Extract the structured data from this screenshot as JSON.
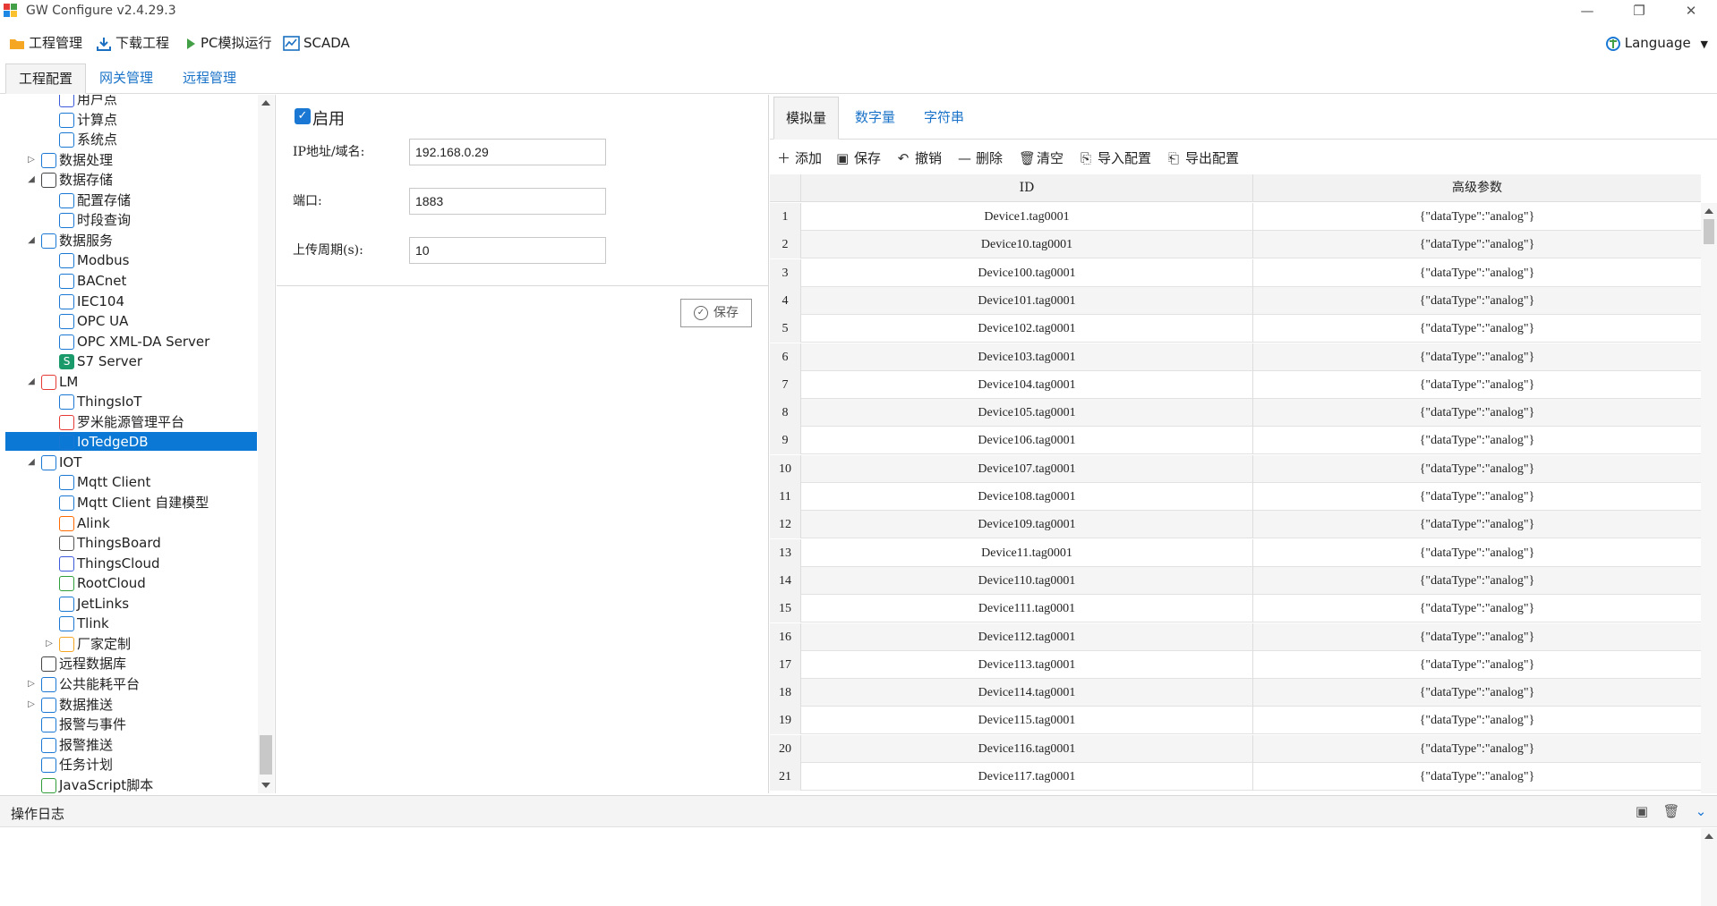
{
  "window": {
    "title": "GW Configure v2.4.29.3",
    "minimize": "—",
    "restore": "❐",
    "close": "✕"
  },
  "toolbar": {
    "project_mgmt": "工程管理",
    "download_project": "下载工程",
    "pc_simulate": "PC模拟运行",
    "scada": "SCADA",
    "language": "Language"
  },
  "main_tabs": [
    "工程配置",
    "网关管理",
    "远程管理"
  ],
  "tree": {
    "items": [
      {
        "label": "用户点",
        "icon": "user-point-icon"
      },
      {
        "label": "计算点",
        "icon": "calc-point-icon"
      },
      {
        "label": "系统点",
        "icon": "system-point-icon"
      },
      {
        "label": "数据处理",
        "icon": "data-process-icon",
        "expander": "▷"
      },
      {
        "label": "数据存储",
        "icon": "database-icon",
        "expander": "◢"
      },
      {
        "label": "配置存储",
        "icon": "gear-icon"
      },
      {
        "label": "时段查询",
        "icon": "search-icon"
      },
      {
        "label": "数据服务",
        "icon": "data-service-icon",
        "expander": "◢"
      },
      {
        "label": "Modbus",
        "icon": "modbus-icon"
      },
      {
        "label": "BACnet",
        "icon": "bacnet-icon"
      },
      {
        "label": "IEC104",
        "icon": "iec104-icon"
      },
      {
        "label": "OPC UA",
        "icon": "opcua-icon"
      },
      {
        "label": "OPC XML-DA Server",
        "icon": "opc-xml-icon"
      },
      {
        "label": "S7 Server",
        "icon": "s7-icon",
        "glyph": "S"
      },
      {
        "label": "LM",
        "icon": "lm-logo-icon",
        "expander": "◢"
      },
      {
        "label": "ThingsIoT",
        "icon": "wifi-signal-icon"
      },
      {
        "label": "罗米能源管理平台",
        "icon": "lm-logo-icon"
      },
      {
        "label": "IoTedgeDB",
        "icon": "wifi-signal-icon",
        "selected": true
      },
      {
        "label": "IOT",
        "icon": "iot-network-icon",
        "expander": "◢"
      },
      {
        "label": "Mqtt Client",
        "icon": "wifi-signal-icon"
      },
      {
        "label": "Mqtt Client 自建模型",
        "icon": "wifi-signal-icon"
      },
      {
        "label": "Alink",
        "icon": "alink-icon"
      },
      {
        "label": "ThingsBoard",
        "icon": "thingsboard-icon"
      },
      {
        "label": "ThingsCloud",
        "icon": "thingscloud-icon"
      },
      {
        "label": "RootCloud",
        "icon": "rootcloud-icon"
      },
      {
        "label": "JetLinks",
        "icon": "jetlinks-icon"
      },
      {
        "label": "Tlink",
        "icon": "tlink-icon"
      },
      {
        "label": "厂家定制",
        "icon": "folder-icon",
        "expander": "▷"
      },
      {
        "label": "远程数据库",
        "icon": "remote-db-icon"
      },
      {
        "label": "公共能耗平台",
        "icon": "energy-chart-icon",
        "expander": "▷"
      },
      {
        "label": "数据推送",
        "icon": "push-icon",
        "expander": "▷"
      },
      {
        "label": "报警与事件",
        "icon": "bell-icon"
      },
      {
        "label": "报警推送",
        "icon": "alarm-push-icon"
      },
      {
        "label": "任务计划",
        "icon": "calendar-icon"
      },
      {
        "label": "JavaScript脚本",
        "icon": "script-icon"
      }
    ]
  },
  "config": {
    "enable_label": "启用",
    "enable_checked": true,
    "ip_label": "IP地址/域名:",
    "ip_value": "192.168.0.29",
    "port_label": "端口:",
    "port_value": "1883",
    "period_label": "上传周期(s):",
    "period_value": "10",
    "save_label": "保存"
  },
  "data_tabs": [
    "模拟量",
    "数字量",
    "字符串"
  ],
  "data_tools": [
    "添加",
    "保存",
    "撤销",
    "删除",
    "清空",
    "导入配置",
    "导出配置"
  ],
  "grid": {
    "col_id": "ID",
    "col_adv": "高级参数",
    "rows": [
      {
        "n": "1",
        "id": "Device1.tag0001",
        "adv": "{\"dataType\":\"analog\"}"
      },
      {
        "n": "2",
        "id": "Device10.tag0001",
        "adv": "{\"dataType\":\"analog\"}"
      },
      {
        "n": "3",
        "id": "Device100.tag0001",
        "adv": "{\"dataType\":\"analog\"}"
      },
      {
        "n": "4",
        "id": "Device101.tag0001",
        "adv": "{\"dataType\":\"analog\"}"
      },
      {
        "n": "5",
        "id": "Device102.tag0001",
        "adv": "{\"dataType\":\"analog\"}"
      },
      {
        "n": "6",
        "id": "Device103.tag0001",
        "adv": "{\"dataType\":\"analog\"}"
      },
      {
        "n": "7",
        "id": "Device104.tag0001",
        "adv": "{\"dataType\":\"analog\"}"
      },
      {
        "n": "8",
        "id": "Device105.tag0001",
        "adv": "{\"dataType\":\"analog\"}"
      },
      {
        "n": "9",
        "id": "Device106.tag0001",
        "adv": "{\"dataType\":\"analog\"}"
      },
      {
        "n": "10",
        "id": "Device107.tag0001",
        "adv": "{\"dataType\":\"analog\"}"
      },
      {
        "n": "11",
        "id": "Device108.tag0001",
        "adv": "{\"dataType\":\"analog\"}"
      },
      {
        "n": "12",
        "id": "Device109.tag0001",
        "adv": "{\"dataType\":\"analog\"}"
      },
      {
        "n": "13",
        "id": "Device11.tag0001",
        "adv": "{\"dataType\":\"analog\"}"
      },
      {
        "n": "14",
        "id": "Device110.tag0001",
        "adv": "{\"dataType\":\"analog\"}"
      },
      {
        "n": "15",
        "id": "Device111.tag0001",
        "adv": "{\"dataType\":\"analog\"}"
      },
      {
        "n": "16",
        "id": "Device112.tag0001",
        "adv": "{\"dataType\":\"analog\"}"
      },
      {
        "n": "17",
        "id": "Device113.tag0001",
        "adv": "{\"dataType\":\"analog\"}"
      },
      {
        "n": "18",
        "id": "Device114.tag0001",
        "adv": "{\"dataType\":\"analog\"}"
      },
      {
        "n": "19",
        "id": "Device115.tag0001",
        "adv": "{\"dataType\":\"analog\"}"
      },
      {
        "n": "20",
        "id": "Device116.tag0001",
        "adv": "{\"dataType\":\"analog\"}"
      },
      {
        "n": "21",
        "id": "Device117.tag0001",
        "adv": "{\"dataType\":\"analog\"}"
      }
    ]
  },
  "log": {
    "title": "操作日志"
  },
  "colors": {
    "accent": "#0a78d4",
    "tab_link": "#1a73c8"
  }
}
